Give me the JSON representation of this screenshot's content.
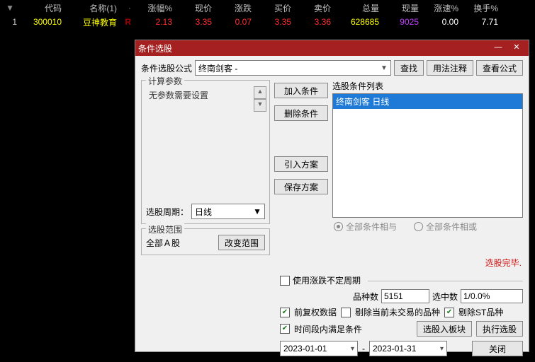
{
  "table": {
    "headers": {
      "idx": "",
      "code": "代码",
      "name": "名称(1)",
      "dot": "·",
      "pct": "涨幅%",
      "price": "现价",
      "diff": "涨跌",
      "bid": "买价",
      "ask": "卖价",
      "vol": "总量",
      "nowv": "现量",
      "speed": "涨速%",
      "turn": "换手%"
    },
    "row": {
      "idx": "1",
      "code": "300010",
      "name": "豆神教育",
      "r": "R",
      "pct": "2.13",
      "price": "3.35",
      "diff": "0.07",
      "bid": "3.35",
      "ask": "3.36",
      "vol": "628685",
      "nowv": "9025",
      "speed": "0.00",
      "turn": "7.71"
    }
  },
  "dialog": {
    "title": "条件选股",
    "formula_label": "条件选股公式",
    "formula_value": "终南剑客   -",
    "btn_find": "查找",
    "btn_help": "用法注释",
    "btn_view": "查看公式",
    "group_params": "计算参数",
    "no_params": "无参数需要设置",
    "period_label": "选股周期：",
    "period_value": "日线",
    "group_range": "选股范围",
    "range_value": "全部Ａ股",
    "btn_change_range": "改变范围",
    "btn_add": "加入条件",
    "btn_del": "删除条件",
    "btn_import": "引入方案",
    "btn_save": "保存方案",
    "list_label": "选股条件列表",
    "list_item": "终南剑客  日线",
    "radio_and": "全部条件相与",
    "radio_or": "全部条件相或",
    "done": "选股完毕.",
    "chk_variable": "使用涨跌不定周期",
    "stats_kinds_label": "品种数",
    "stats_kinds": "5151",
    "stats_sel_label": "选中数",
    "stats_sel": "1/0.0%",
    "chk_fq": "前复权数据",
    "chk_rm_nontrade": "剔除当前未交易的品种",
    "chk_rm_st": "剔除ST品种",
    "chk_timerange": "时间段内满足条件",
    "btn_to_block": "选股入板块",
    "btn_exec": "执行选股",
    "btn_close": "关闭",
    "date_from": "2023-01-01",
    "date_to": "2023-01-31",
    "date_sep": "-"
  }
}
